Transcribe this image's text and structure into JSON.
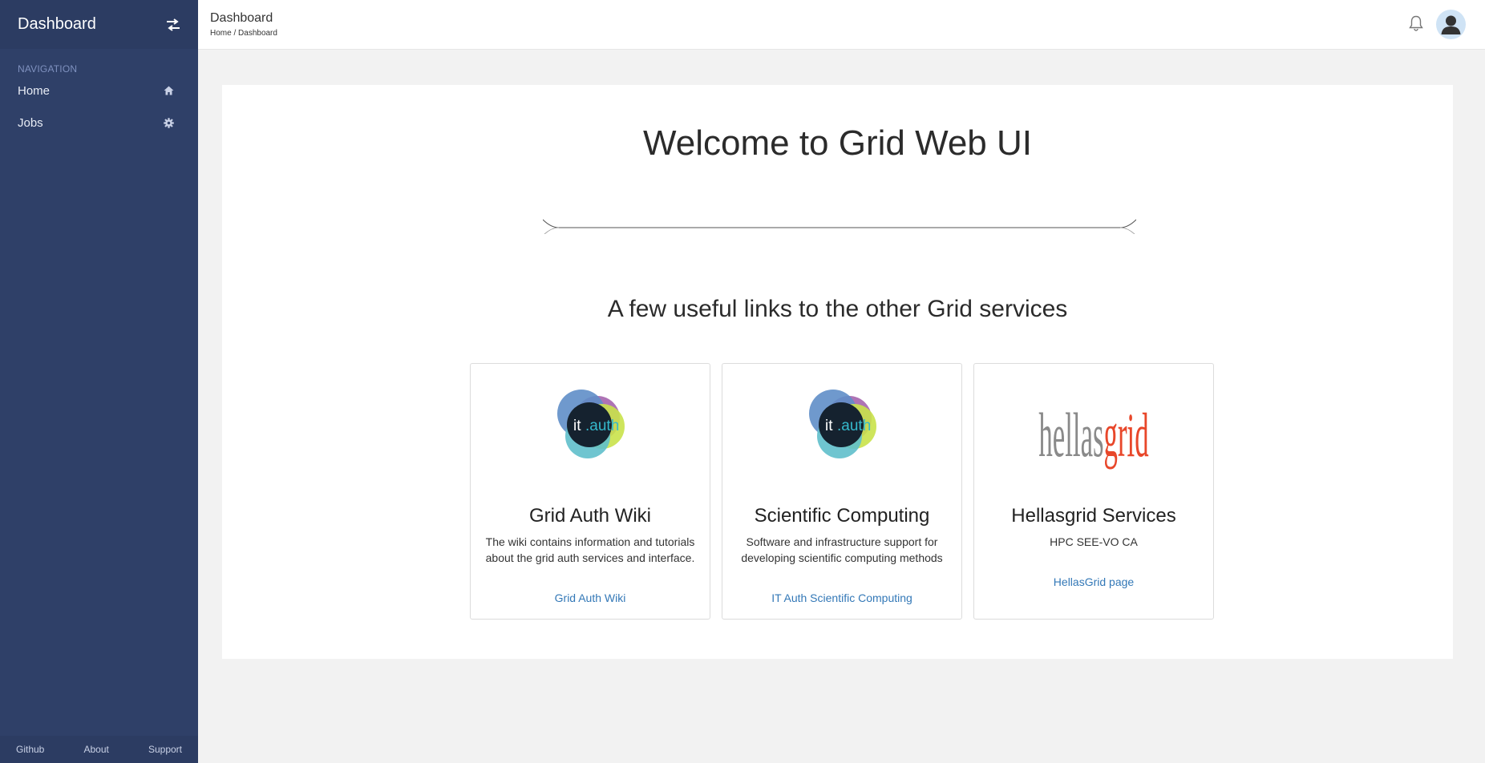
{
  "sidebar": {
    "title": "Dashboard",
    "nav_label": "NAVIGATION",
    "items": [
      {
        "label": "Home",
        "icon": "home-icon"
      },
      {
        "label": "Jobs",
        "icon": "gear-icon"
      }
    ],
    "footer": {
      "github": "Github",
      "about": "About",
      "support": "Support"
    }
  },
  "header": {
    "title": "Dashboard",
    "breadcrumb": {
      "home": "Home",
      "separator": " / ",
      "current": "Dashboard"
    }
  },
  "main": {
    "welcome": "Welcome to Grid Web UI",
    "subtitle": "A few useful links to the other Grid services",
    "cards": [
      {
        "title": "Grid Auth Wiki",
        "description": "The wiki contains information and tutorials about the grid auth services and interface.",
        "link": "Grid Auth Wiki",
        "logo_text_a": "it",
        "logo_text_b": ".auth"
      },
      {
        "title": "Scientific Computing",
        "description": "Software and infrastructure support for developing scientific computing methods",
        "link": "IT Auth Scientific Computing",
        "logo_text_a": "it",
        "logo_text_b": ".auth"
      },
      {
        "title": "Hellasgrid Services",
        "description": "HPC SEE-VO CA",
        "link": "HellasGrid page",
        "logo_text_a": "hellas",
        "logo_text_b": "grid"
      }
    ]
  },
  "colors": {
    "sidebar": "#2f4068",
    "link": "#3378b7",
    "hellas_grey": "#8a8a8a",
    "hellas_red": "#e8472a"
  }
}
